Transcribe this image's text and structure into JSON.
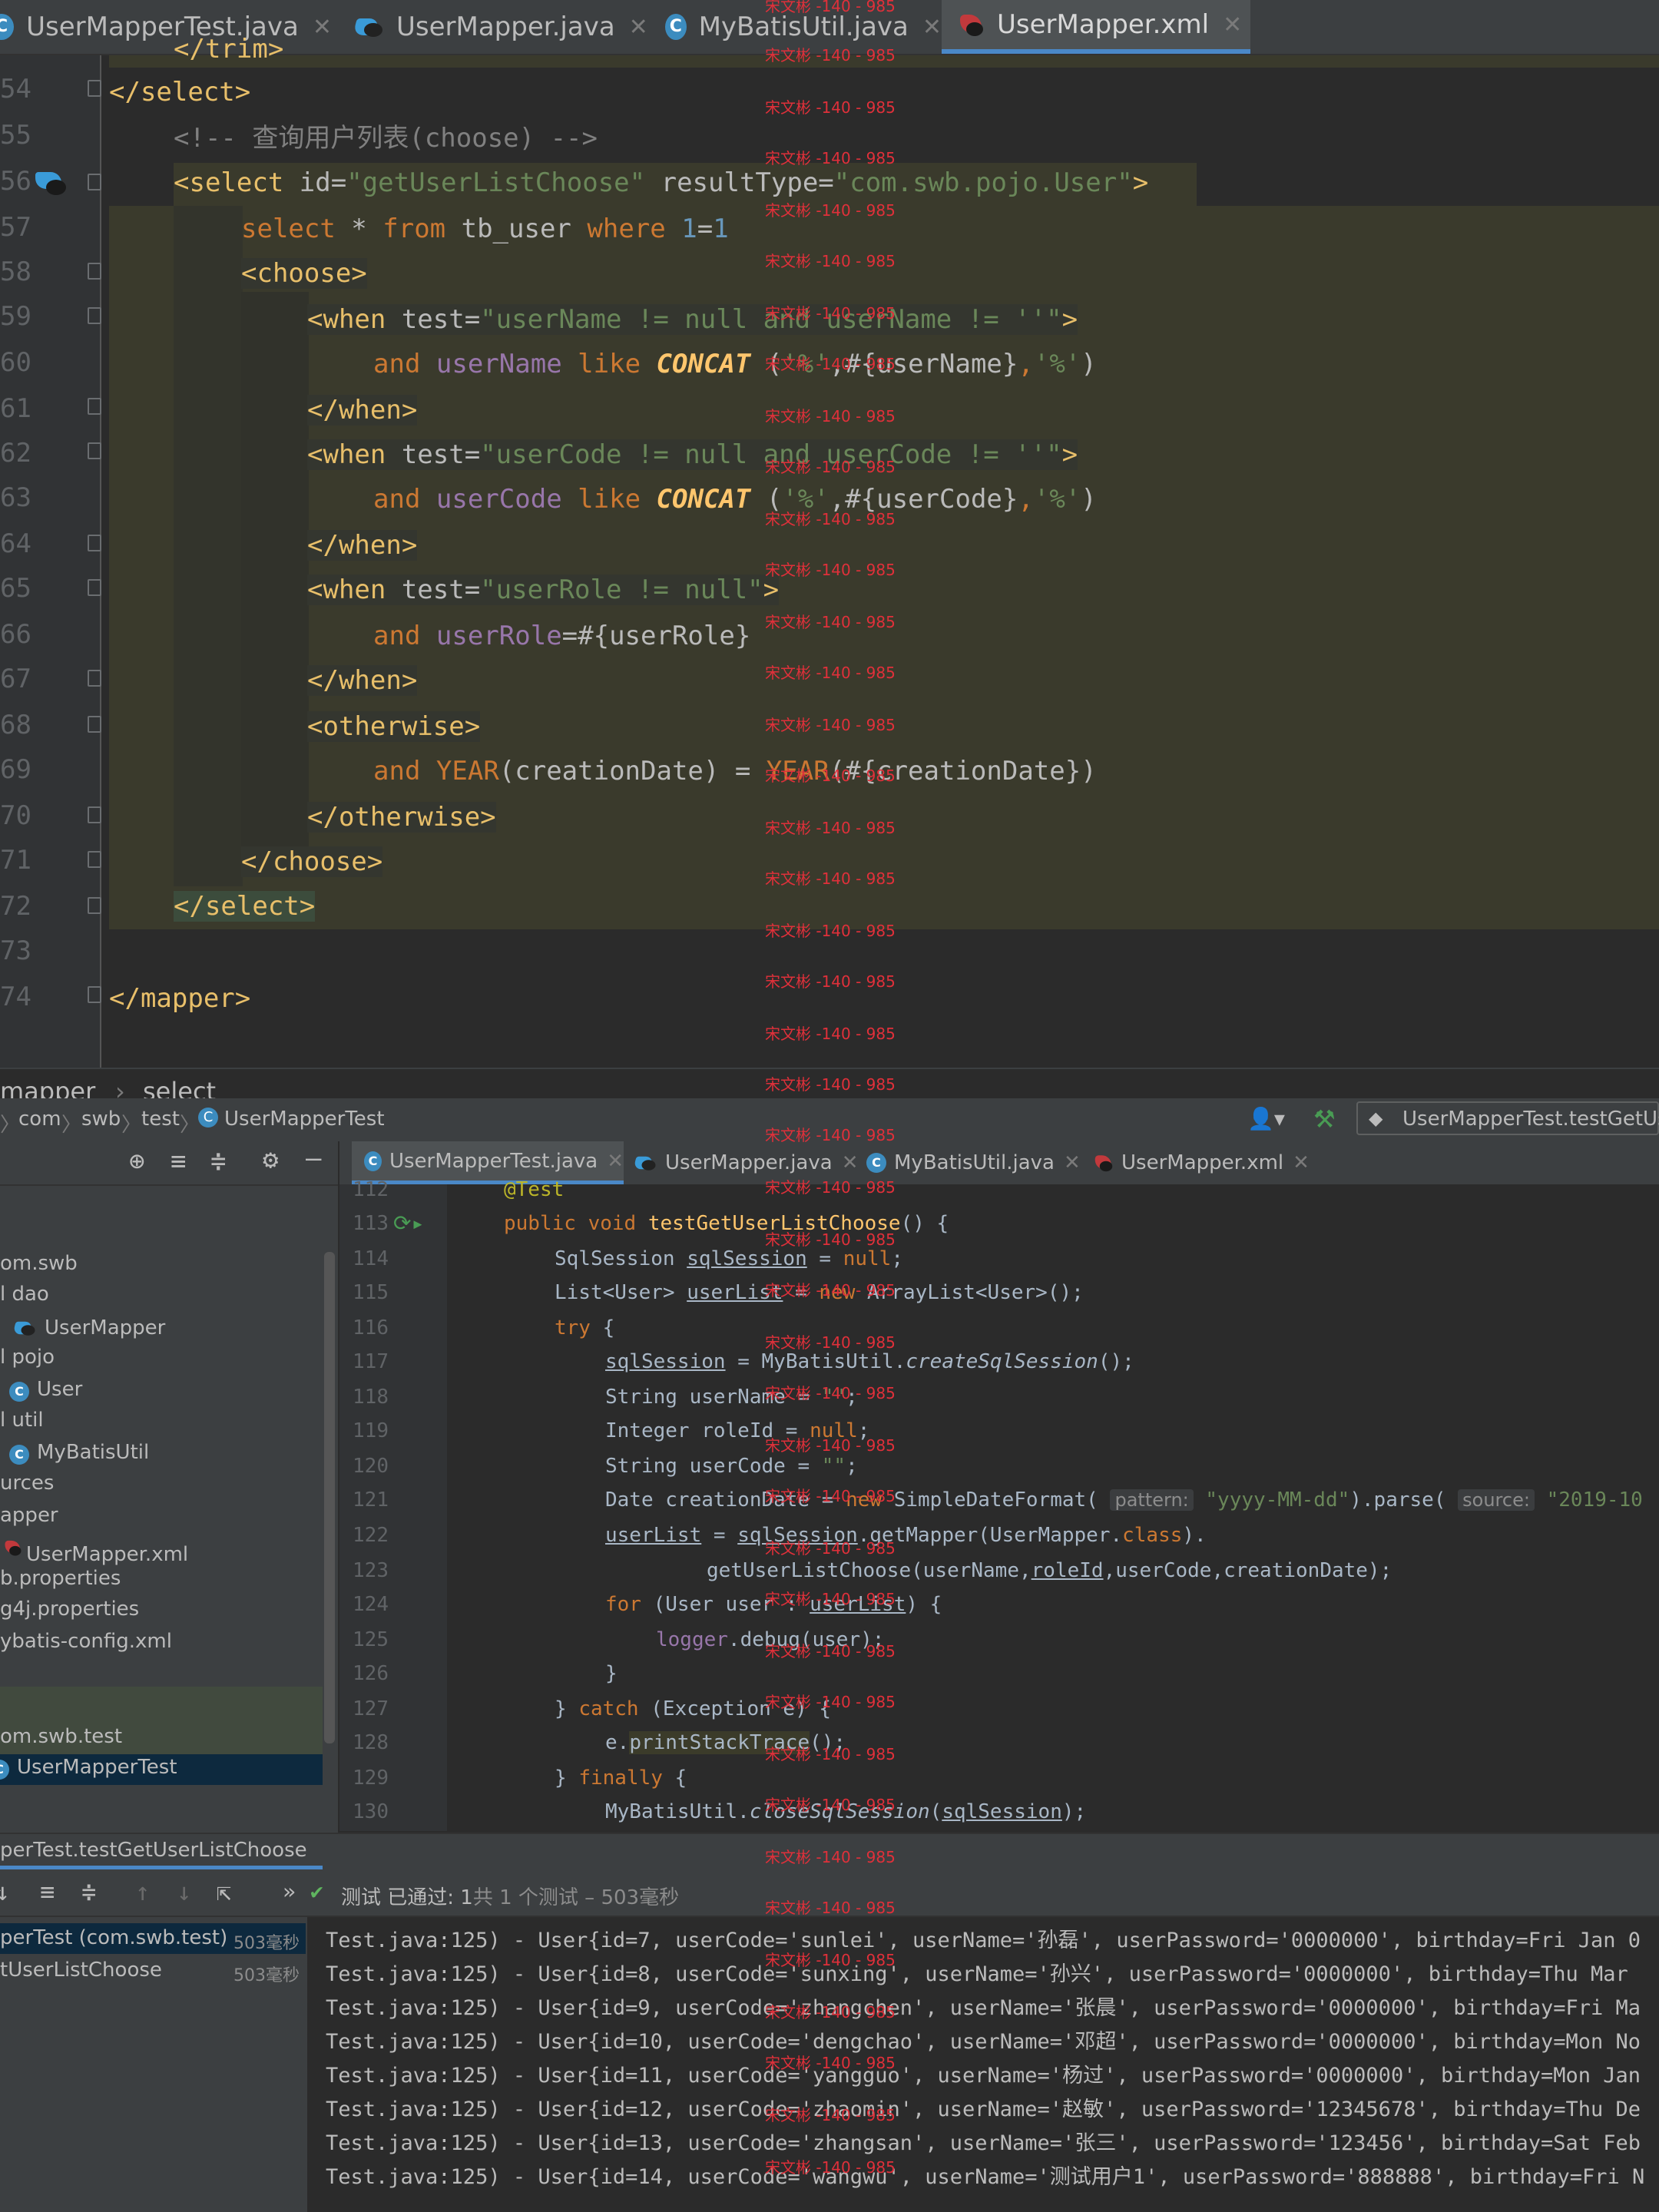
{
  "top_tabs": [
    {
      "label": "UserMapperTest.java",
      "icon": "class-icon"
    },
    {
      "label": "UserMapper.java",
      "icon": "mapper-icon"
    },
    {
      "label": "MyBatisUtil.java",
      "icon": "class-icon"
    },
    {
      "label": "UserMapper.xml",
      "icon": "xml-icon",
      "active": true
    }
  ],
  "editor1": {
    "line_numbers": [
      "54",
      "55",
      "56",
      "57",
      "58",
      "59",
      "60",
      "61",
      "62",
      "63",
      "64",
      "65",
      "66",
      "67",
      "68",
      "69",
      "70",
      "71",
      "72",
      "73",
      "74"
    ],
    "top_partial": "</trim>",
    "lines": {
      "l54": "</select>",
      "l55": "<!-- 查询用户列表(choose) -->",
      "l56_tag": "<select",
      "l56_a1": " id=",
      "l56_v1": "\"getUserListChoose\"",
      "l56_a2": " resultType=",
      "l56_v2": "\"com.swb.pojo.User\"",
      "l56_end": ">",
      "l57": [
        "select",
        " * ",
        "from",
        " tb_user ",
        "where",
        " ",
        "1",
        "=",
        "1"
      ],
      "l58": "<choose>",
      "l59_tag": "<when",
      "l59_a": " test=",
      "l59_v": "\"userName != null and userName != ''\"",
      "l59_end": ">",
      "l60": [
        "and",
        " ",
        "userName",
        " ",
        "like",
        " ",
        "CONCAT",
        " (",
        "'%'",
        ",#{userName}",
        ",",
        "'%'",
        ")"
      ],
      "l61": "</when>",
      "l62_tag": "<when",
      "l62_a": " test=",
      "l62_v": "\"userCode != null and userCode != ''\"",
      "l62_end": ">",
      "l63": [
        "and",
        " ",
        "userCode",
        " ",
        "like",
        " ",
        "CONCAT",
        " (",
        "'%'",
        ",#{userCode}",
        ",",
        "'%'",
        ")"
      ],
      "l64": "</when>",
      "l65_tag": "<when",
      "l65_a": " test=",
      "l65_v": "\"userRole != null\"",
      "l65_end": ">",
      "l66": [
        "and",
        " ",
        "userRole",
        "=#{userRole}"
      ],
      "l67": "</when>",
      "l68": "<otherwise>",
      "l69": [
        "and",
        " ",
        "YEAR",
        "(creationDate) = ",
        "YEAR",
        "(#{creationDate})"
      ],
      "l70": "</otherwise>",
      "l71": "</choose>",
      "l72": "</select>",
      "l74": "</mapper>"
    }
  },
  "watermark": "宋文彬 -140 - 985",
  "breadcrumb": {
    "items": [
      "mapper",
      "select"
    ]
  },
  "nav_path": {
    "items": [
      "com",
      "swb",
      "test",
      "UserMapperTest"
    ],
    "run_config": "UserMapperTest.testGetUse"
  },
  "project_tree": [
    "om.swb",
    "l dao",
    "UserMapper",
    "l pojo",
    "User",
    "l util",
    "MyBatisUtil",
    "urces",
    "apper",
    "UserMapper.xml",
    "b.properties",
    "g4j.properties",
    "ybatis-config.xml",
    "om.swb.test",
    "UserMapperTest"
  ],
  "lower_tabs": [
    {
      "label": "UserMapperTest.java",
      "active": true
    },
    {
      "label": "UserMapper.java"
    },
    {
      "label": "MyBatisUtil.java"
    },
    {
      "label": "UserMapper.xml"
    }
  ],
  "editor2": {
    "line_numbers": [
      "112",
      "113",
      "114",
      "115",
      "116",
      "117",
      "118",
      "119",
      "120",
      "121",
      "122",
      "123",
      "124",
      "125",
      "126",
      "127",
      "128",
      "129",
      "130"
    ],
    "annotation": "@Test",
    "hints": {
      "pattern": "pattern:",
      "source": "source:"
    }
  },
  "run": {
    "tab_label": "perTest.testGetUserListChoose",
    "status_prefix": "测试 已通过: ",
    "status_count": "1",
    "status_suffix": "共 1 个测试 – 503毫秒",
    "tree": [
      {
        "label": "perTest (com.swb.test)",
        "time": "503毫秒"
      },
      {
        "label": "tUserListChoose",
        "time": "503毫秒"
      }
    ],
    "console": [
      "Test.java:125) - User{id=7, userCode='sunlei', userName='孙磊', userPassword='0000000', birthday=Fri Jan 0",
      "Test.java:125) - User{id=8, userCode='sunxing', userName='孙兴', userPassword='0000000', birthday=Thu Mar",
      "Test.java:125) - User{id=9, userCode='zhangchen', userName='张晨', userPassword='0000000', birthday=Fri Ma",
      "Test.java:125) - User{id=10, userCode='dengchao', userName='邓超', userPassword='0000000', birthday=Mon No",
      "Test.java:125) - User{id=11, userCode='yangguo', userName='杨过', userPassword='0000000', birthday=Mon Jan",
      "Test.java:125) - User{id=12, userCode='zhaomin', userName='赵敏', userPassword='12345678', birthday=Thu De",
      "Test.java:125) - User{id=13, userCode='zhangsan', userName='张三', userPassword='123456', birthday=Sat Feb",
      "Test.java:125) - User{id=14, userCode='wangwu', userName='测试用户1', userPassword='888888', birthday=Fri N"
    ]
  }
}
